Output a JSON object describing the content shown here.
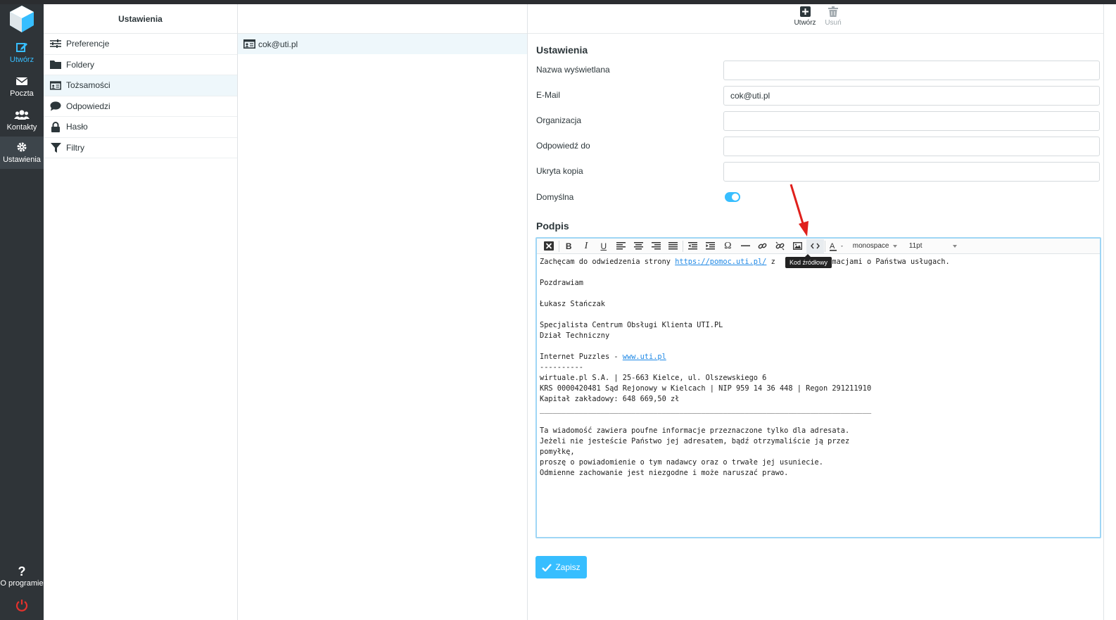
{
  "nav": {
    "compose": "Utwórz",
    "mail": "Poczta",
    "contacts": "Kontakty",
    "settings": "Ustawienia",
    "about": "O programie"
  },
  "settings_menu": {
    "title": "Ustawienia",
    "items": [
      {
        "label": "Preferencje",
        "icon": "sliders-icon"
      },
      {
        "label": "Foldery",
        "icon": "folder-icon"
      },
      {
        "label": "Tożsamości",
        "icon": "id-card-icon"
      },
      {
        "label": "Odpowiedzi",
        "icon": "comment-icon"
      },
      {
        "label": "Hasło",
        "icon": "lock-icon"
      },
      {
        "label": "Filtry",
        "icon": "filter-icon"
      }
    ]
  },
  "identities": {
    "items": [
      {
        "label": "cok@uti.pl"
      }
    ]
  },
  "toolbar": {
    "create": "Utwórz",
    "delete": "Usuń"
  },
  "form": {
    "title": "Ustawienia",
    "display_name_label": "Nazwa wyświetlana",
    "display_name_value": "",
    "email_label": "E-Mail",
    "email_value": "cok@uti.pl",
    "organization_label": "Organizacja",
    "organization_value": "",
    "reply_to_label": "Odpowiedź do",
    "reply_to_value": "",
    "bcc_label": "Ukryta kopia",
    "bcc_value": "",
    "default_label": "Domyślna",
    "default_on": true,
    "signature_title": "Podpis",
    "save_label": "Zapisz"
  },
  "editor": {
    "font": "monospace",
    "size": "11pt",
    "tooltip": "Kod źródłowy",
    "lines": [
      {
        "before": "Zachęcam do odwiedzenia strony ",
        "link": "https://pomoc.uti.pl/",
        "after": " z        informacjami o Państwa usługach."
      },
      {
        "text": ""
      },
      {
        "text": "Pozdrawiam"
      },
      {
        "text": ""
      },
      {
        "text": "Łukasz Stańczak"
      },
      {
        "text": ""
      },
      {
        "text": "Specjalista Centrum Obsługi Klienta UTI.PL"
      },
      {
        "text": "Dział Techniczny"
      },
      {
        "text": ""
      },
      {
        "before": "Internet Puzzles - ",
        "link": "www.uti.pl",
        "after": ""
      },
      {
        "text": "----------"
      },
      {
        "text": "wirtuale.pl S.A. | 25-663 Kielce, ul. Olszewskiego 6"
      },
      {
        "text": "KRS 0000420481 Sąd Rejonowy w Kielcach | NIP 959 14 36 448 | Regon 291211910"
      },
      {
        "text": "Kapitał zakładowy: 648 669,50 zł"
      },
      {
        "text": "____________________________________________________________________________"
      },
      {
        "text": ""
      },
      {
        "text": "Ta wiadomość zawiera poufne informacje przeznaczone tylko dla adresata."
      },
      {
        "text": "Jeżeli nie jesteście Państwo jej adresatem, bądź otrzymaliście ją przez"
      },
      {
        "text": "pomyłkę,"
      },
      {
        "text": "proszę o powiadomienie o tym nadawcy oraz o trwałe jej usuniecie."
      },
      {
        "text": "Odmienne zachowanie jest niezgodne i może naruszać prawo."
      }
    ]
  },
  "colors": {
    "accent": "#37beff",
    "nav_bg": "#2f3438",
    "annotation_arrow": "#e0201c"
  }
}
